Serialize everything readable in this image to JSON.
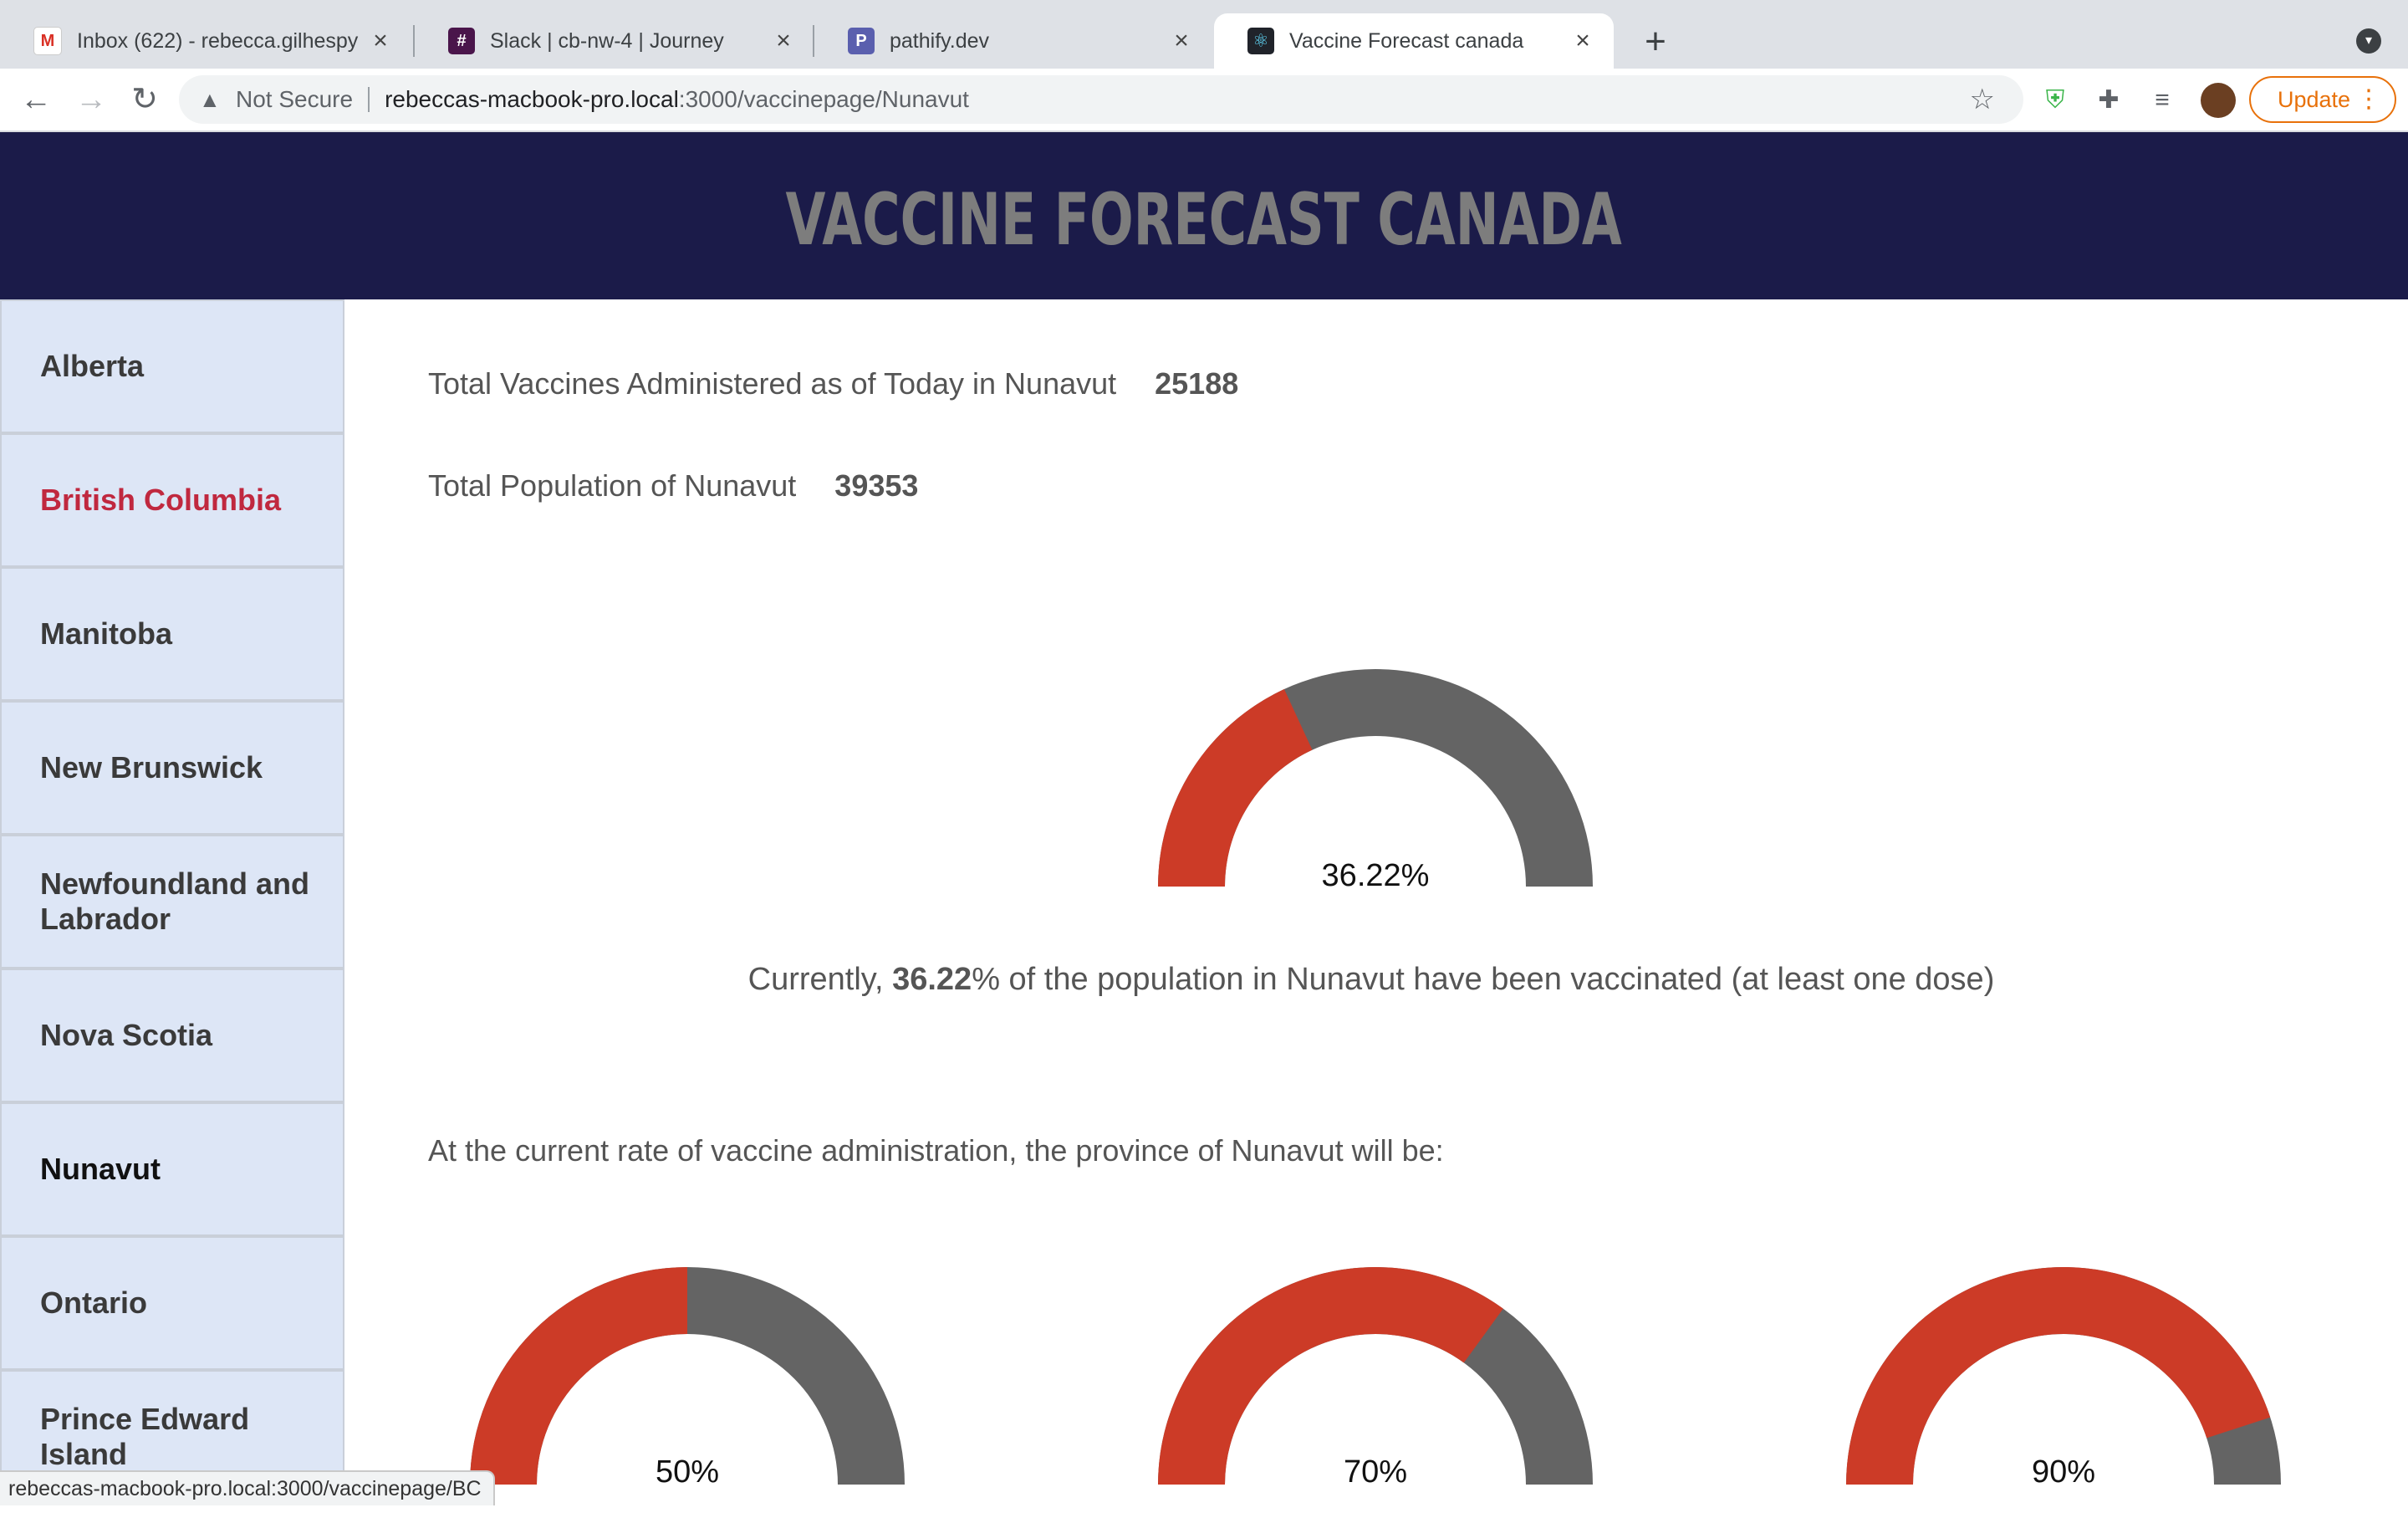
{
  "browser": {
    "tabs": [
      {
        "title": "Inbox (622) - rebecca.gilhespy",
        "icon": "gmail-icon",
        "active": false
      },
      {
        "title": "Slack | cb-nw-4 | Journey",
        "icon": "slack-icon",
        "active": false
      },
      {
        "title": "pathify.dev",
        "icon": "pathify-icon",
        "active": false
      },
      {
        "title": "Vaccine Forecast canada",
        "icon": "react-icon",
        "active": true
      }
    ],
    "security_label": "Not Secure",
    "url_host": "rebeccas-macbook-pro.local",
    "url_path": ":3000/vaccinepage/Nunavut",
    "update_label": "Update",
    "status_url": "rebeccas-macbook-pro.local:3000/vaccinepage/BC"
  },
  "site": {
    "title": "Vaccine Forecast Canada"
  },
  "sidebar": {
    "items": [
      {
        "label": "Alberta"
      },
      {
        "label": "British Columbia"
      },
      {
        "label": "Manitoba"
      },
      {
        "label": "New Brunswick"
      },
      {
        "label": "Newfoundland and Labrador"
      },
      {
        "label": "Nova Scotia"
      },
      {
        "label": "Nunavut"
      },
      {
        "label": "Ontario"
      },
      {
        "label": "Prince Edward Island"
      }
    ],
    "hovered": "British Columbia",
    "selected": "Nunavut"
  },
  "main": {
    "vaccines_label": "Total Vaccines Administered as of Today in Nunavut",
    "vaccines_value": "25188",
    "population_label": "Total Population of Nunavut",
    "population_value": "39353",
    "main_gauge": {
      "label": "36.22%",
      "fraction": 0.3622
    },
    "caption_prefix": "Currently,",
    "caption_value": "36.22",
    "caption_suffix": "% of the population in Nunavut have been vaccinated (at least one dose)",
    "forecast_text": "At the current rate of vaccine administration, the province of Nunavut will be:",
    "forecast_gauges": [
      {
        "label": "50%",
        "fraction": 0.5
      },
      {
        "label": "70%",
        "fraction": 0.7
      },
      {
        "label": "90%",
        "fraction": 0.9
      }
    ]
  },
  "colors": {
    "filled": "#cc3b27",
    "remaining": "#646464",
    "banner": "#1b1b49",
    "sidebar_bg": "#dde6f6",
    "hover_text": "#c0283f"
  }
}
